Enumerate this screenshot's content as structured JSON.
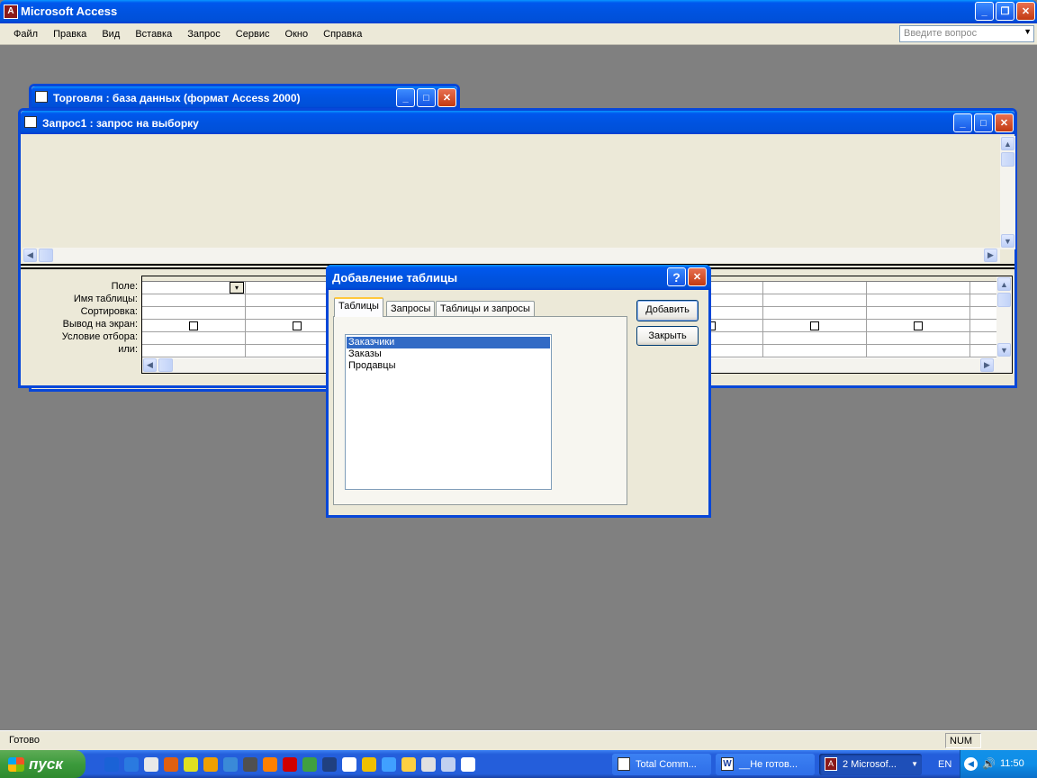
{
  "app": {
    "title": "Microsoft Access",
    "menu": [
      "Файл",
      "Правка",
      "Вид",
      "Вставка",
      "Запрос",
      "Сервис",
      "Окно",
      "Справка"
    ],
    "help_placeholder": "Введите вопрос"
  },
  "db_window": {
    "title": "Торговля : база данных (формат Access 2000)"
  },
  "query_window": {
    "title": "Запрос1 : запрос на выборку",
    "row_labels": [
      "Поле:",
      "Имя таблицы:",
      "Сортировка:",
      "Вывод на экран:",
      "Условие отбора:",
      "или:"
    ]
  },
  "dialog": {
    "title": "Добавление таблицы",
    "help_button": "?",
    "tabs": [
      "Таблицы",
      "Запросы",
      "Таблицы и запросы"
    ],
    "active_tab": "Таблицы",
    "list_items": [
      "Заказчики",
      "Заказы",
      "Продавцы"
    ],
    "selected_item": "Заказчики",
    "add_button": "Добавить",
    "close_button": "Закрыть"
  },
  "status": {
    "left": "Готово",
    "right": "NUM"
  },
  "taskbar": {
    "start": "пуск",
    "tasks": [
      "Total Comm...",
      "__Не готов...",
      "2 Microsof..."
    ],
    "lang": "EN",
    "time": "11:50"
  },
  "colors": {
    "title_blue": "#0054e3",
    "face": "#ece9d8",
    "desktop": "#808080",
    "taskbar": "#245edb",
    "start_green": "#3c9a3c",
    "selection": "#316ac5"
  }
}
